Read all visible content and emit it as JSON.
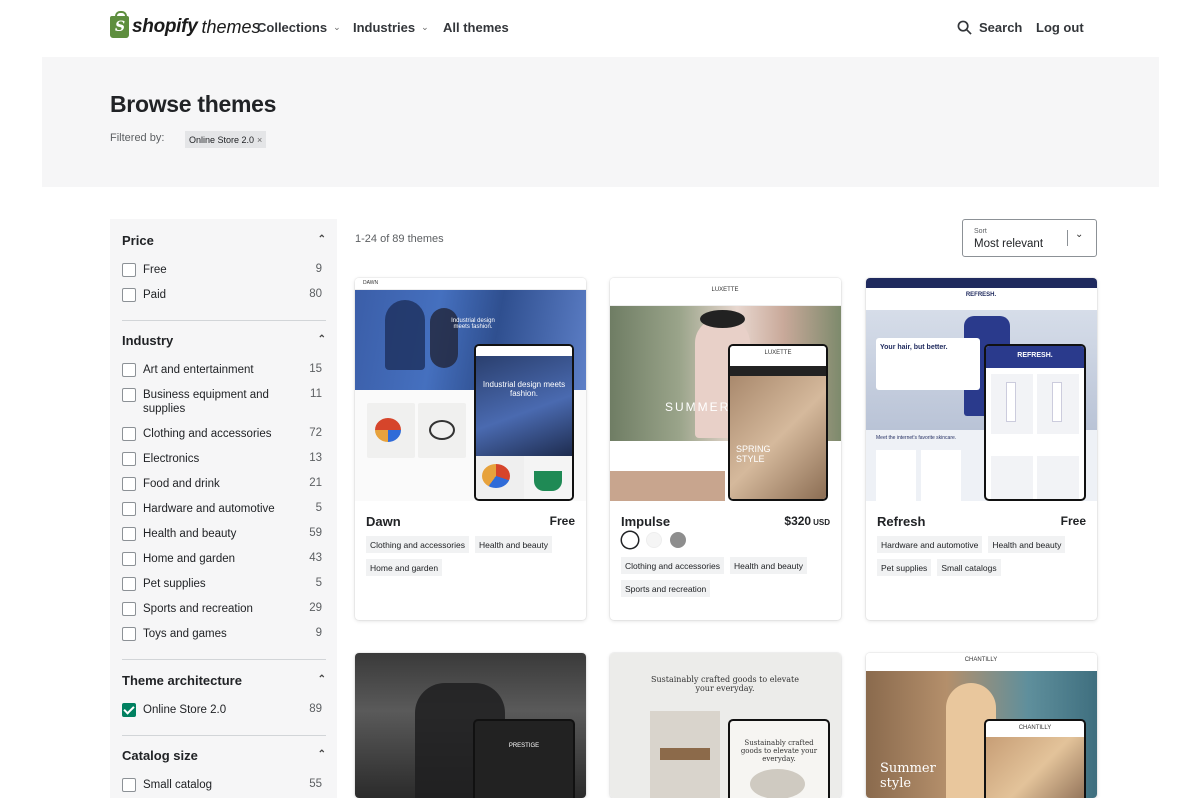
{
  "header": {
    "logo_shopify": "shopify",
    "logo_themes": "themes",
    "nav": [
      {
        "label": "Collections",
        "has_dropdown": true
      },
      {
        "label": "Industries",
        "has_dropdown": true
      },
      {
        "label": "All themes",
        "has_dropdown": false
      }
    ],
    "search_label": "Search",
    "logout_label": "Log out"
  },
  "hero": {
    "title": "Browse themes",
    "filtered_by_label": "Filtered by:",
    "active_filter": "Online Store 2.0"
  },
  "sidebar": {
    "sections": [
      {
        "title": "Price",
        "options": [
          {
            "label": "Free",
            "count": "9",
            "checked": false
          },
          {
            "label": "Paid",
            "count": "80",
            "checked": false
          }
        ]
      },
      {
        "title": "Industry",
        "options": [
          {
            "label": "Art and entertainment",
            "count": "15",
            "checked": false
          },
          {
            "label": "Business equipment and supplies",
            "count": "11",
            "checked": false
          },
          {
            "label": "Clothing and accessories",
            "count": "72",
            "checked": false
          },
          {
            "label": "Electronics",
            "count": "13",
            "checked": false
          },
          {
            "label": "Food and drink",
            "count": "21",
            "checked": false
          },
          {
            "label": "Hardware and automotive",
            "count": "5",
            "checked": false
          },
          {
            "label": "Health and beauty",
            "count": "59",
            "checked": false
          },
          {
            "label": "Home and garden",
            "count": "43",
            "checked": false
          },
          {
            "label": "Pet supplies",
            "count": "5",
            "checked": false
          },
          {
            "label": "Sports and recreation",
            "count": "29",
            "checked": false
          },
          {
            "label": "Toys and games",
            "count": "9",
            "checked": false
          }
        ]
      },
      {
        "title": "Theme architecture",
        "options": [
          {
            "label": "Online Store 2.0",
            "count": "89",
            "checked": true
          }
        ]
      },
      {
        "title": "Catalog size",
        "options": [
          {
            "label": "Small catalog",
            "count": "55",
            "checked": false
          }
        ]
      }
    ]
  },
  "results": {
    "count_text": "1-24 of 89 themes",
    "sort_label": "Sort",
    "sort_value": "Most relevant"
  },
  "themes": [
    {
      "name": "Dawn",
      "price": "Free",
      "tags": [
        "Clothing and accessories",
        "Health and beauty",
        "Home and garden"
      ]
    },
    {
      "name": "Impulse",
      "price": "$320",
      "currency": "USD",
      "swatch_colors": [
        "#ffffff",
        "#f5f5f5",
        "#8e8e8e"
      ],
      "tags": [
        "Clothing and accessories",
        "Health and beauty",
        "Sports and recreation"
      ]
    },
    {
      "name": "Refresh",
      "price": "Free",
      "tags": [
        "Hardware and automotive",
        "Health and beauty",
        "Pet supplies",
        "Small catalogs"
      ]
    }
  ],
  "previews": {
    "dawn_brand": "DAWN",
    "dawn_headline": "Industrial design meets fashion.",
    "impulse_brand": "LUXETTE",
    "impulse_word": "SUMMER",
    "impulse_phone_text": "SPRING STYLE",
    "refresh_brand": "REFRESH.",
    "refresh_headline": "Your hair, but better.",
    "refresh_sub": "Meet the internet's favorite skincare.",
    "row2_c1_brand": "PRESTIGE",
    "row2_c2_headline": "Sustainably crafted goods to elevate your everyday.",
    "row2_c3_brand": "CHANTILLY",
    "row2_c3_headline": "Summer style"
  },
  "colors": {
    "accent_green": "#008060",
    "logo_green": "#5e8e3e",
    "refresh_navy": "#1f2a5e"
  }
}
